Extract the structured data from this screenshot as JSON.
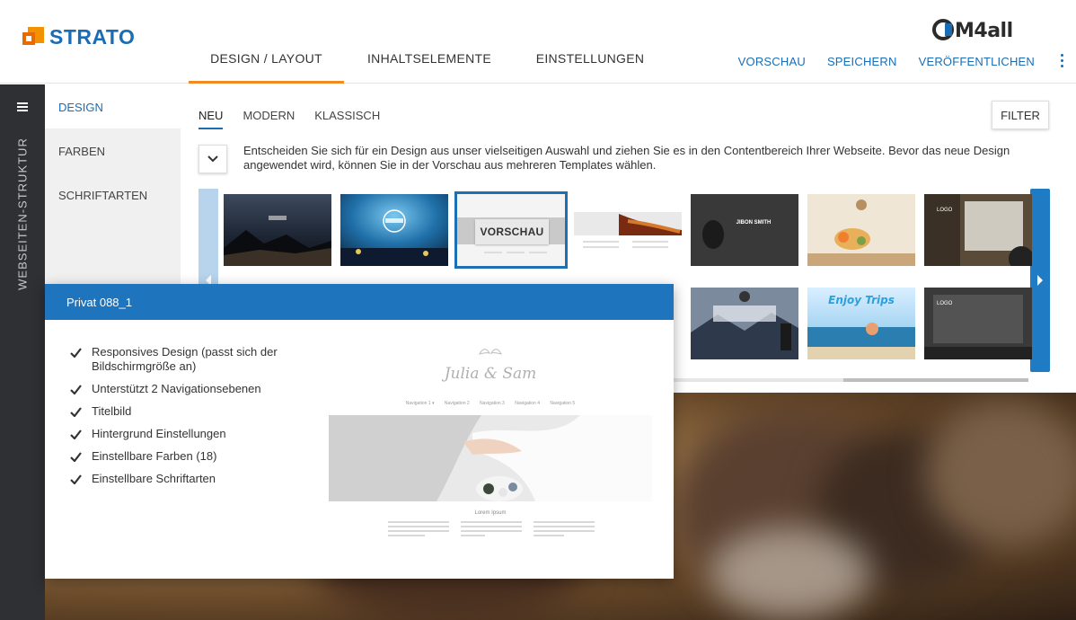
{
  "header": {
    "brand": "STRATO",
    "cm4all_logo": "CM4all",
    "tabs": [
      {
        "label": "DESIGN / LAYOUT",
        "active": true
      },
      {
        "label": "INHALTSELEMENTE",
        "active": false
      },
      {
        "label": "EINSTELLUNGEN",
        "active": false
      }
    ],
    "actions": [
      "VORSCHAU",
      "SPEICHERN",
      "VERÖFFENTLICHEN"
    ],
    "menu_icon": "kebab-vertical-icon"
  },
  "rail": {
    "menu_icon": "hamburger-icon",
    "label": "WEBSEITEN-STRUKTUR"
  },
  "subnav": {
    "items": [
      {
        "label": "DESIGN",
        "active": true
      },
      {
        "label": "FARBEN",
        "active": false
      },
      {
        "label": "SCHRIFTARTEN",
        "active": false
      }
    ]
  },
  "content": {
    "filter_tabs": [
      {
        "label": "NEU",
        "active": true
      },
      {
        "label": "MODERN",
        "active": false
      },
      {
        "label": "KLASSISCH",
        "active": false
      }
    ],
    "filter_button": "FILTER",
    "description": "Entscheiden Sie sich für ein Design aus unser vielseitigen Auswahl und ziehen Sie es in den Contentbereich Ihrer Webseite. Bevor das neue Design angewendet wird, können Sie in der Vorschau aus mehreren Templates wählen.",
    "preview_overlay": "VORSCHAU",
    "thumb_text": {
      "jibon": "JIBON SMITH",
      "enjoy": "Enjoy Trips",
      "logo": "LOGO"
    },
    "colors": {
      "accent": "#1a6db4",
      "tab_underline": "#f08a24",
      "popup_header": "#1f75bd"
    }
  },
  "popup": {
    "title": "Privat 088_1",
    "features": [
      "Responsives Design (passt sich der Bildschirmgröße an)",
      "Unterstützt 2 Navigationsebenen",
      "Titelbild",
      "Hintergrund Einstellungen",
      "Einstellbare Farben (18)",
      "Einstellbare Schriftarten"
    ],
    "preview": {
      "site_title": "Julia & Sam",
      "nav": [
        "Navigation 1 ▾",
        "Navigation 2",
        "Navigation 3",
        "Navigation 4",
        "Navigation 5"
      ],
      "heading": "Lorem Ipsum"
    }
  }
}
